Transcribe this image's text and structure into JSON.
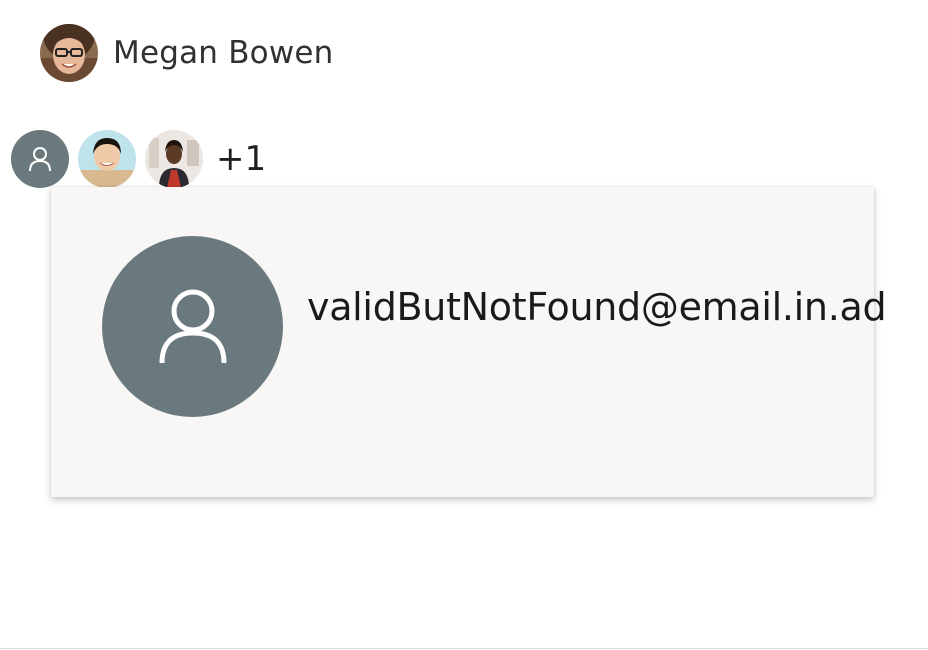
{
  "person": {
    "name": "Megan Bowen",
    "avatar_icon": "megan-bowen-photo"
  },
  "facepile": {
    "avatars": [
      {
        "icon": "person-icon",
        "kind": "generic"
      },
      {
        "icon": "person-photo-1",
        "kind": "photo"
      },
      {
        "icon": "person-photo-2",
        "kind": "photo"
      }
    ],
    "overflow_label": "+1"
  },
  "card": {
    "email": "validButNotFound@email.in.ad",
    "avatar_icon": "person-icon"
  },
  "colors": {
    "avatar_bg": "#69797e",
    "card_bg": "#f8f7f6",
    "text": "#323130"
  }
}
